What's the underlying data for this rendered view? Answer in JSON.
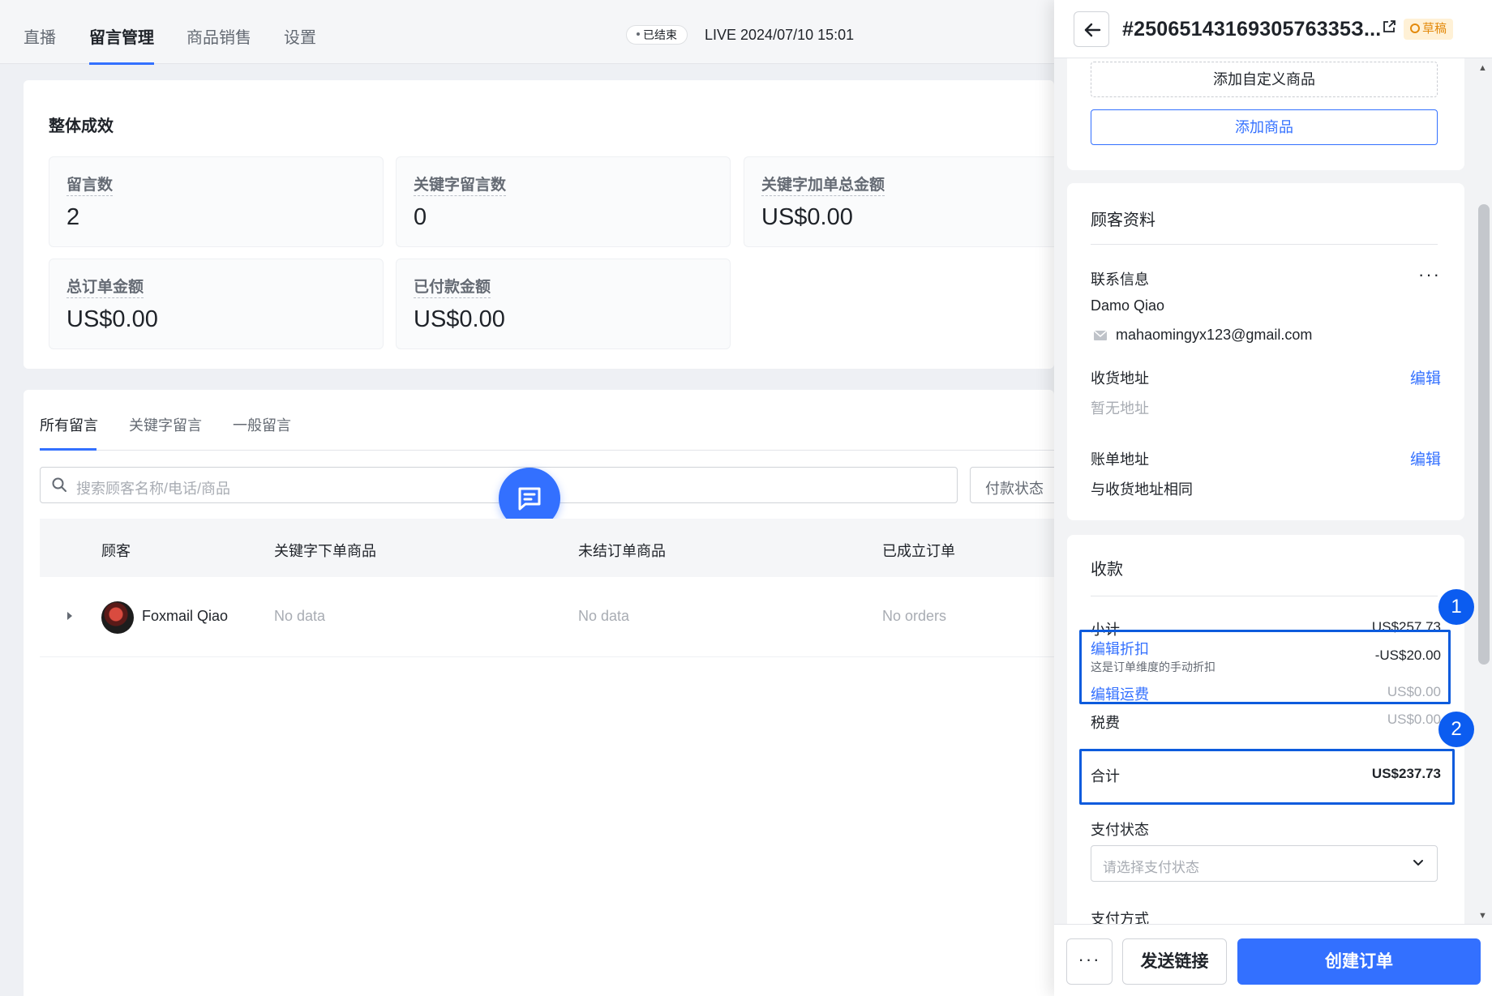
{
  "topnav": {
    "tabs": [
      {
        "label": "直播"
      },
      {
        "label": "留言管理"
      },
      {
        "label": "商品销售"
      },
      {
        "label": "设置"
      }
    ],
    "status": "已结束",
    "live_time": "LIVE 2024/07/10 15:01"
  },
  "performance": {
    "title": "整体成效",
    "stats": [
      {
        "label": "留言数",
        "value": "2"
      },
      {
        "label": "关键字留言数",
        "value": "0"
      },
      {
        "label": "关键字加单总金额",
        "value": "US$0.00"
      },
      {
        "label": "总订单金额",
        "value": "US$0.00"
      },
      {
        "label": "已付款金额",
        "value": "US$0.00"
      }
    ]
  },
  "messages": {
    "tabs": [
      {
        "label": "所有留言"
      },
      {
        "label": "关键字留言"
      },
      {
        "label": "一般留言"
      }
    ],
    "search_placeholder": "搜索顾客名称/电话/商品",
    "filter_label": "付款状态",
    "columns": [
      "顾客",
      "关键字下单商品",
      "未结订单商品",
      "已成立订单"
    ],
    "rows": [
      {
        "customer": "Foxmail Qiao",
        "keyword_items": "No data",
        "open_items": "No data",
        "orders": "No orders"
      }
    ]
  },
  "drawer": {
    "order_id": "#2506514316930576335З...",
    "badge": "草稿",
    "products": {
      "add_custom": "添加自定义商品",
      "add_product": "添加商品"
    },
    "customer": {
      "title": "顾客资料",
      "contact_label": "联系信息",
      "more": "···",
      "name": "Damo Qiao",
      "email": "mahaomingyx123@gmail.com",
      "shipping_label": "收货地址",
      "shipping_edit": "编辑",
      "shipping_value": "暂无地址",
      "billing_label": "账单地址",
      "billing_edit": "编辑",
      "billing_value": "与收货地址相同"
    },
    "payment": {
      "title": "收款",
      "subtotal_label": "小计",
      "subtotal_value": "US$257.73",
      "discount_label": "编辑折扣",
      "discount_note": "这是订单维度的手动折扣",
      "discount_value": "-US$20.00",
      "shipping_label": "编辑运费",
      "shipping_value": "US$0.00",
      "tax_label": "税费",
      "tax_value": "US$0.00",
      "total_label": "合计",
      "total_value": "US$237.73",
      "status_label": "支付状态",
      "status_placeholder": "请选择支付状态",
      "method_label": "支付方式"
    },
    "annotations": [
      "1",
      "2"
    ],
    "footer": {
      "more": "···",
      "send": "发送链接",
      "create": "创建订单"
    }
  }
}
